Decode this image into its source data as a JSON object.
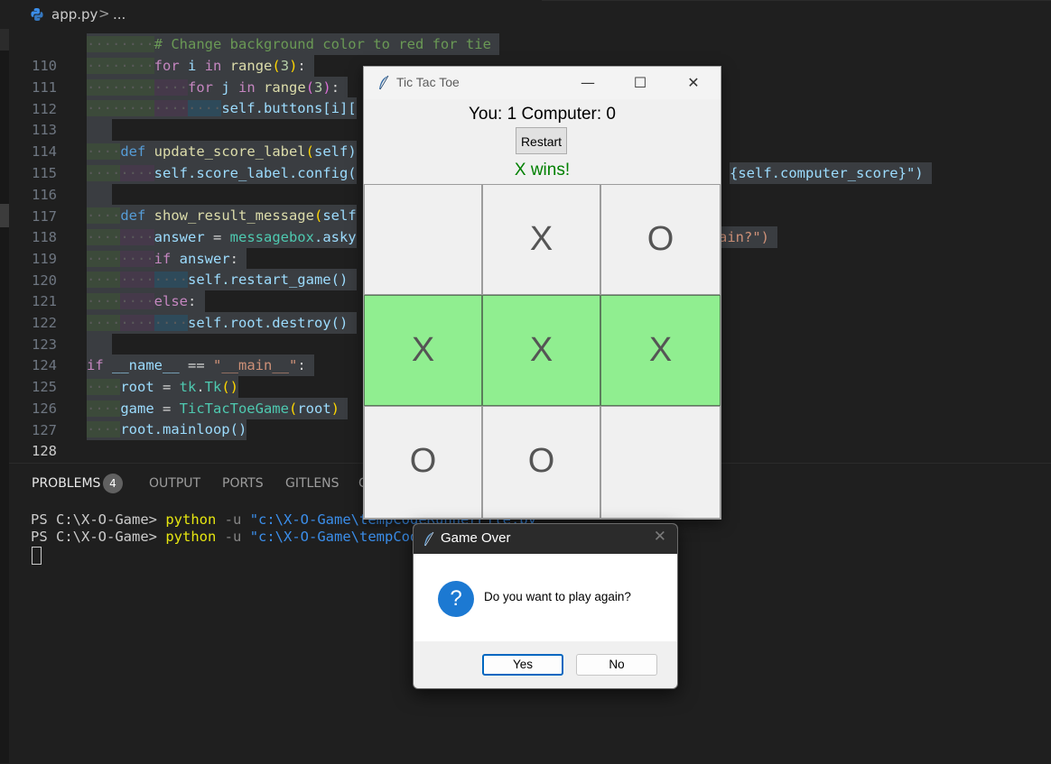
{
  "breadcrumb": {
    "file": "app.py",
    "separator": ">",
    "more": "..."
  },
  "editor": {
    "lines": [
      {
        "num": "110"
      },
      {
        "num": "111"
      },
      {
        "num": "112"
      },
      {
        "num": "113"
      },
      {
        "num": "114"
      },
      {
        "num": "115"
      },
      {
        "num": "116"
      },
      {
        "num": "117"
      },
      {
        "num": "118"
      },
      {
        "num": "119"
      },
      {
        "num": "120"
      },
      {
        "num": "121"
      },
      {
        "num": "122"
      },
      {
        "num": "123"
      },
      {
        "num": "124"
      },
      {
        "num": "125"
      },
      {
        "num": "126"
      },
      {
        "num": "127"
      },
      {
        "num": "128"
      }
    ],
    "code": {
      "l110": "# Change background color to red for tie",
      "l111_kw": "for",
      "l111_var": "i",
      "l111_in": "in",
      "l111_fn": "range",
      "l111_num": "3",
      "l111_end": ":",
      "l112_kw": "for",
      "l112_var": "j",
      "l112_in": "in",
      "l112_fn": "range",
      "l112_num": "3",
      "l112_end": ":",
      "l113": "self.buttons[i][",
      "l115_def": "def",
      "l115_fn": "update_score_label",
      "l115_rest": "self)",
      "l116": "self.score_label.config(",
      "l116_tail": "{self.computer_score}\")",
      "l118_def": "def",
      "l118_fn": "show_result_message",
      "l118_rest": "self",
      "l119_var": "answer",
      "l119_eq": " = ",
      "l119_mod": "messagebox",
      "l119_rest": ".asky",
      "l119_tail": "ain?\")",
      "l120_kw": "if",
      "l120_var": "answer",
      "l120_end": ":",
      "l121": "self.restart_game()",
      "l122_kw": "else",
      "l122_end": ":",
      "l123": "self.root.destroy()",
      "l125_kw": "if",
      "l125_name": "__name__",
      "l125_eq": " == ",
      "l125_str": "\"__main__\"",
      "l125_end": ":",
      "l126_var": "root",
      "l126_eq": " = ",
      "l126_mod": "tk",
      "l126_cls": "Tk",
      "l126_end": "()",
      "l127_var": "game",
      "l127_eq": " = ",
      "l127_cls": "TicTacToeGame",
      "l127_arg": "root",
      "l127_end": ")",
      "l128": "root.mainloop()"
    }
  },
  "panel": {
    "tabs": [
      "PROBLEMS",
      "OUTPUT",
      "PORTS",
      "GITLENS",
      "C"
    ],
    "problems_count": "4",
    "terminal": [
      {
        "prompt": "PS C:\\X-O-Game>",
        "cmd": "python",
        "opt": "-u",
        "path": "\"c:\\X-O-Game\\tempCodeRunnerFile.py"
      },
      {
        "prompt": "PS C:\\X-O-Game>",
        "cmd": "python",
        "opt": "-u",
        "path": "\"c:\\X-O-Game\\tempCode"
      }
    ]
  },
  "game_window": {
    "title": "Tic Tac Toe",
    "score": "You: 1 Computer: 0",
    "restart_label": "Restart",
    "status": "X wins!",
    "controls": {
      "minimize": "—",
      "maximize": "☐",
      "close": "✕"
    },
    "board": [
      [
        "",
        "X",
        "O"
      ],
      [
        "X",
        "X",
        "X"
      ],
      [
        "O",
        "O",
        ""
      ]
    ],
    "winning_row": 1,
    "colors": {
      "win": "#90ee90",
      "status": "#008000"
    }
  },
  "dialog": {
    "title": "Game Over",
    "message": "Do you want to play again?",
    "icon": "?",
    "yes_label": "Yes",
    "no_label": "No",
    "close": "✕"
  }
}
